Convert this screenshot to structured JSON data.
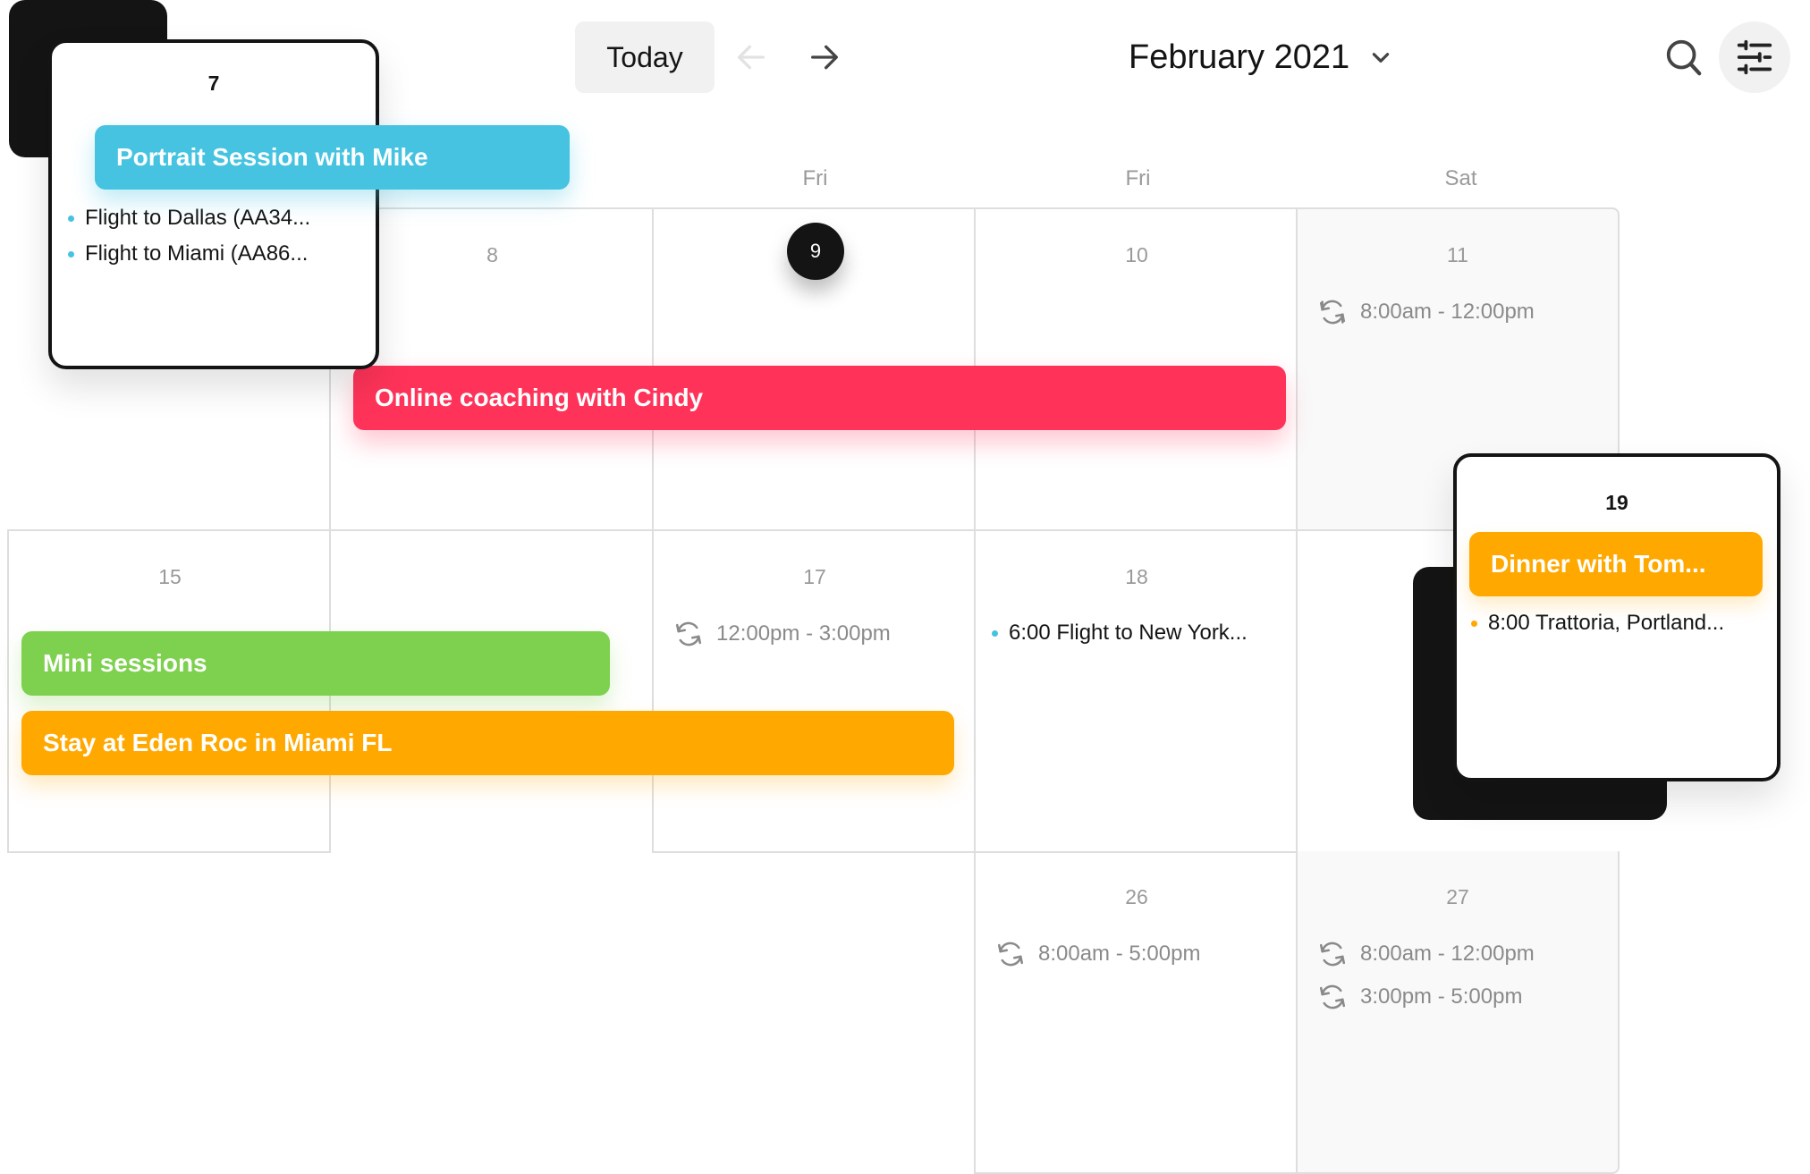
{
  "header": {
    "today_label": "Today",
    "month_title": "February 2021",
    "icons": {
      "prev": "arrow-left-icon",
      "next": "arrow-right-icon",
      "month_dropdown": "chevron-down-icon",
      "search": "search-icon",
      "filter": "sliders-icon"
    }
  },
  "weekdays": [
    "Fri",
    "Fri",
    "Sat"
  ],
  "colors": {
    "blue": "#45c3e1",
    "red": "#ff3359",
    "green": "#7ed04f",
    "orange": "#ffa800",
    "dark": "#141414"
  },
  "cells": {
    "d8": {
      "day": "8"
    },
    "d9": {
      "day": "9",
      "today": true
    },
    "d10": {
      "day": "10"
    },
    "d11": {
      "day": "11",
      "recurring": [
        "8:00am - 12:00pm"
      ]
    },
    "d15": {
      "day": "15"
    },
    "d17": {
      "day": "17",
      "recurring": [
        "12:00pm - 3:00pm"
      ]
    },
    "d18": {
      "day": "18",
      "items": [
        "6:00 Flight to New York..."
      ]
    },
    "d26": {
      "day": "26",
      "recurring": [
        "8:00am - 5:00pm"
      ]
    },
    "d27": {
      "day": "27",
      "recurring": [
        "8:00am - 12:00pm",
        "3:00pm - 5:00pm"
      ]
    }
  },
  "events": {
    "portrait": "Portrait Session with Mike",
    "online": "Online coaching with Cindy",
    "mini": "Mini sessions",
    "stay": "Stay at Eden Roc in Miami FL"
  },
  "popups": {
    "day7": {
      "day": "7",
      "items": [
        "Flight to Dallas (AA34...",
        "Flight to Miami (AA86..."
      ]
    },
    "day19": {
      "day": "19",
      "event": "Dinner with Tom...",
      "items": [
        "8:00 Trattoria, Portland..."
      ]
    }
  }
}
